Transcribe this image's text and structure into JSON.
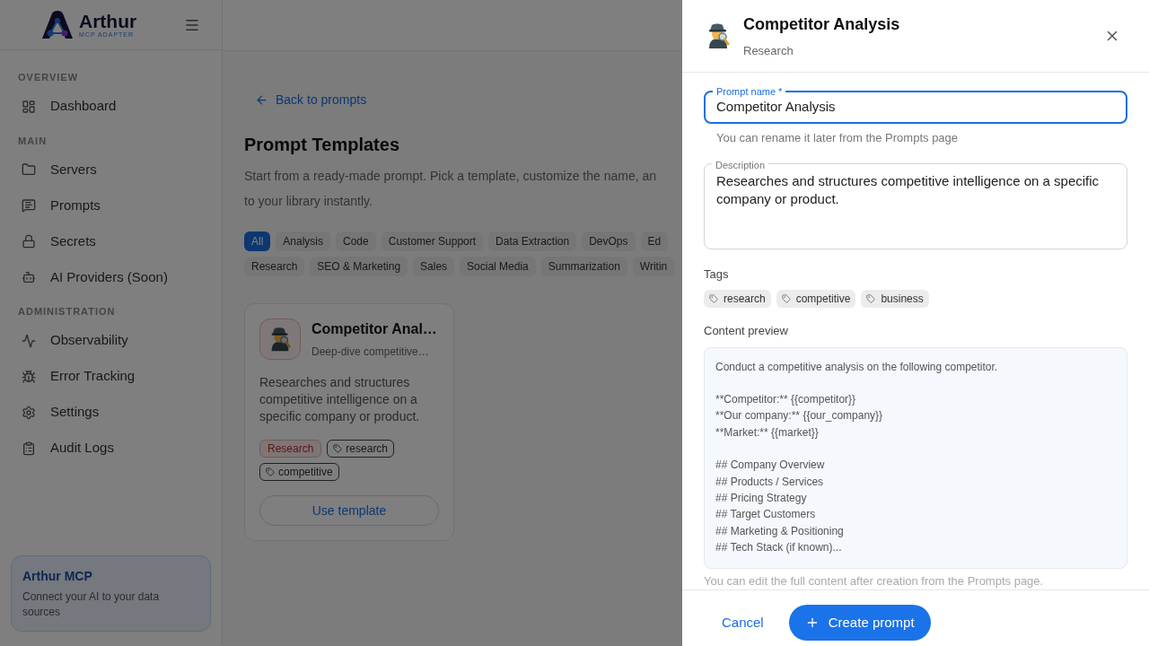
{
  "sidebar": {
    "brand": {
      "name": "Arthur",
      "tagline": "MCP ADAPTER"
    },
    "sections": [
      {
        "title": "OVERVIEW",
        "items": [
          {
            "label": "Dashboard"
          }
        ]
      },
      {
        "title": "MAIN",
        "items": [
          {
            "label": "Servers"
          },
          {
            "label": "Prompts"
          },
          {
            "label": "Secrets"
          },
          {
            "label": "AI Providers (Soon)"
          }
        ]
      },
      {
        "title": "ADMINISTRATION",
        "items": [
          {
            "label": "Observability"
          },
          {
            "label": "Error Tracking"
          },
          {
            "label": "Settings"
          },
          {
            "label": "Audit Logs"
          }
        ]
      }
    ],
    "promo": {
      "title": "Arthur MCP",
      "text": "Connect your AI to your data sources"
    }
  },
  "main": {
    "back_link": "Back to prompts",
    "title": "Prompt Templates",
    "description_lines": [
      "Start from a ready-made prompt. Pick a template, customize the name, an",
      "to your library instantly."
    ],
    "filter_rows": [
      [
        {
          "label": "All",
          "selected": true
        },
        {
          "label": "Analysis",
          "selected": false
        },
        {
          "label": "Code",
          "selected": false
        },
        {
          "label": "Customer Support",
          "selected": false
        },
        {
          "label": "Data Extraction",
          "selected": false
        },
        {
          "label": "DevOps",
          "selected": false
        },
        {
          "label": "Ed",
          "selected": false
        }
      ],
      [
        {
          "label": "Research",
          "selected": false
        },
        {
          "label": "SEO & Marketing",
          "selected": false
        },
        {
          "label": "Sales",
          "selected": false
        },
        {
          "label": "Social Media",
          "selected": false
        },
        {
          "label": "Summarization",
          "selected": false
        },
        {
          "label": "Writin",
          "selected": false
        }
      ]
    ],
    "templates": [
      {
        "title": "Competitor Anal…",
        "subtitle": "Deep-dive competitive…",
        "description": "Researches and structures competitive intelligence on a specific company or product.",
        "category": "Research",
        "tags": [
          "research",
          "competitive"
        ],
        "button": "Use template"
      }
    ]
  },
  "drawer": {
    "title": "Competitor Analysis",
    "subtitle": "Research",
    "name_field": {
      "label": "Prompt name *",
      "value": "Competitor Analysis",
      "focused": true,
      "helper": "You can rename it later from the Prompts page"
    },
    "description_field": {
      "label": "Description",
      "value": "Researches and structures competitive intelligence on a specific company or product.",
      "focused": false
    },
    "tags_label": "Tags",
    "tags": [
      "research",
      "competitive",
      "business"
    ],
    "preview_label": "Content preview",
    "preview_paragraphs": [
      [
        "Conduct a competitive analysis on the following competitor."
      ],
      [
        "**Competitor:** {{competitor}}",
        "**Our company:** {{our_company}}",
        "**Market:** {{market}}"
      ],
      [
        "## Company Overview",
        "## Products / Services",
        "## Pricing Strategy",
        "## Target Customers",
        "## Marketing & Positioning",
        "## Tech Stack (if known)..."
      ]
    ],
    "preview_note": "You can edit the full content after creation from the Prompts page.",
    "cancel": "Cancel",
    "submit": "Create prompt"
  }
}
